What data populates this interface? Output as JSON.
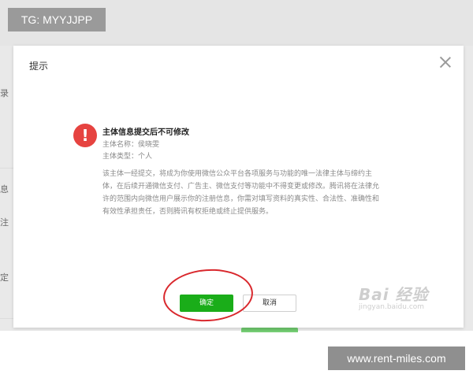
{
  "watermarks": {
    "top_left": "TG: MYYJJPP",
    "bottom_right": "www.rent-miles.com",
    "baidu": "Bai 经验",
    "baidu_sub": "jingyan.baidu.com"
  },
  "background": {
    "side_chars": [
      "录",
      "息",
      "注",
      "定"
    ]
  },
  "dialog": {
    "title": "提示",
    "heading": "主体信息提交后不可修改",
    "subject_name": "主体名称：侯晓雯",
    "subject_type": "主体类型：个人",
    "notice_lines": [
      "该主体一经提交，将成为你使用微信公众平台各项服务与功能的唯一法律主体与缔约主",
      "体，在后续开通微信支付、广告主、微信支付等功能中不得变更或修改。腾讯将在法律允",
      "许的范围内向微信用户展示你的注册信息，你需对填写资料的真实性、合法性、准确性和",
      "有效性承担责任，否则腾讯有权拒绝或终止提供服务。"
    ],
    "warning_glyph": "!",
    "confirm_label": "确定",
    "cancel_label": "取消"
  },
  "colors": {
    "accent_green": "#1aad19",
    "warning_red": "#e64340",
    "annotation_red": "#d9282d"
  },
  "icons": {
    "close": "close-icon",
    "warning": "warning-icon"
  }
}
